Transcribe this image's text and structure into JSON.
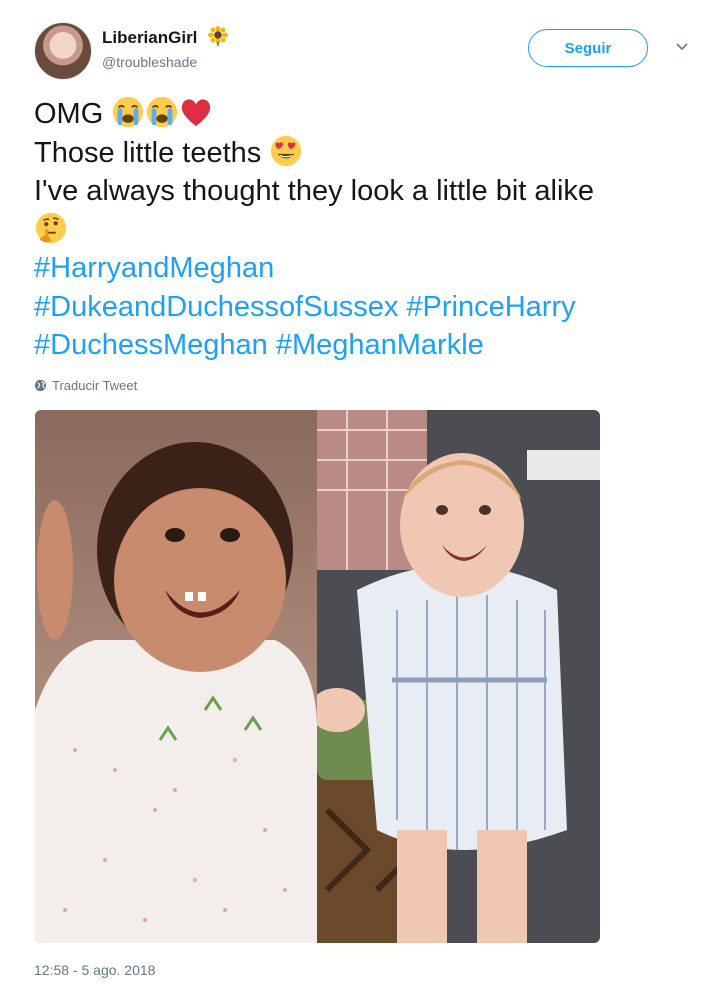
{
  "user": {
    "display_name": "LiberianGirl",
    "handle": "@troubleshade",
    "name_emoji": "sunflower-icon"
  },
  "actions": {
    "follow_label": "Seguir"
  },
  "tweet": {
    "line1_text": "OMG",
    "line2_text": "Those little teeths",
    "line3_text": "I've always thought they look a little bit alike",
    "hashtags": [
      "#HarryandMeghan",
      "#DukeandDuchessofSussex",
      "#PrinceHarry",
      "#DuchessMeghan",
      "#MeghanMarkle"
    ],
    "emojis": [
      "loudly-crying-face-icon",
      "loudly-crying-face-icon",
      "red-heart-icon",
      "heart-eyes-face-icon",
      "thinking-face-icon"
    ]
  },
  "translate_label": "Traducir Tweet",
  "timestamp": "12:58 - 5 ago. 2018",
  "colors": {
    "link": "#1da1f2",
    "text": "#14171a",
    "muted": "#657786"
  }
}
